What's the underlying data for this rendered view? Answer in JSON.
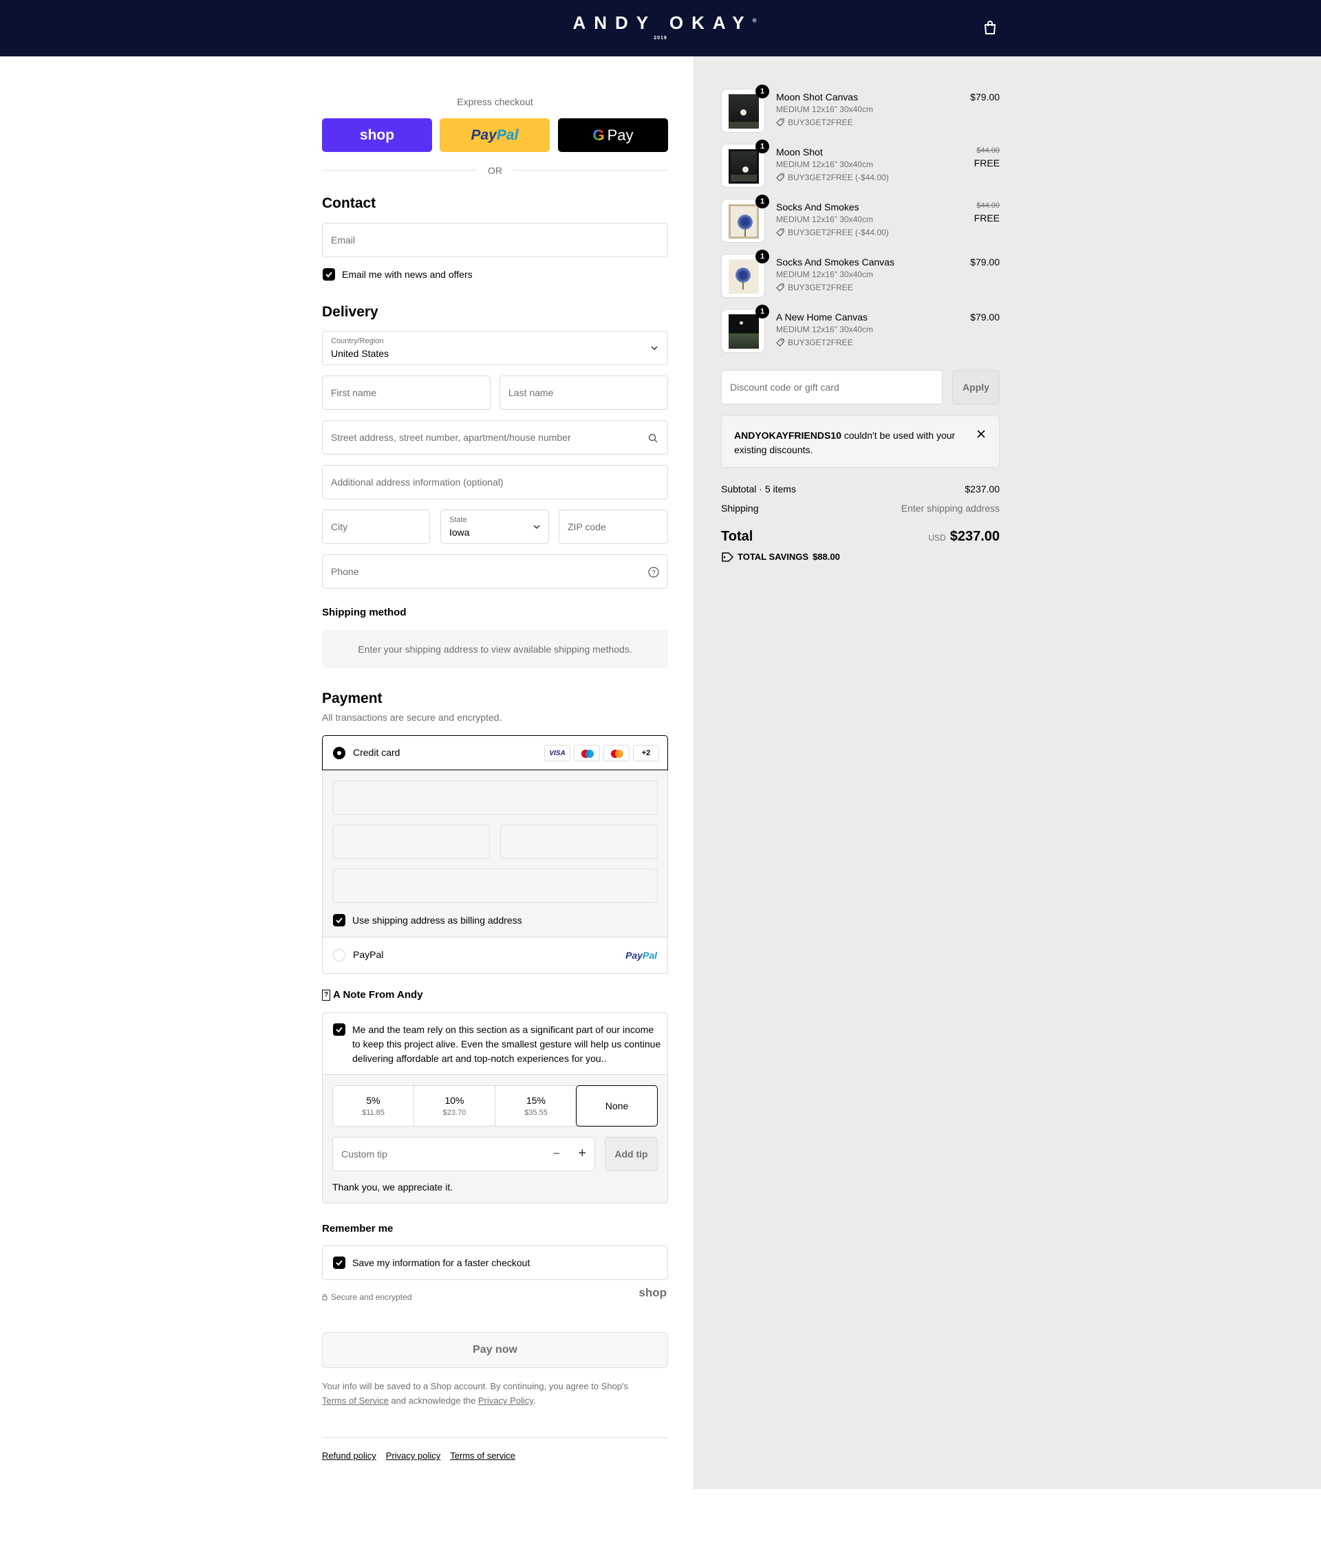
{
  "header": {
    "brand": "ANDY OKAY",
    "brand_mark": "®",
    "year": "2019",
    "cart_icon": "shopping-bag-icon"
  },
  "express": {
    "title": "Express checkout",
    "shop_label": "shop",
    "paypal_label_a": "Pay",
    "paypal_label_b": "Pal",
    "gpay_label": "Pay",
    "or": "OR",
    "colors": {
      "shop": "#5a31f4",
      "paypal": "#ffc439",
      "gpay": "#000000"
    }
  },
  "contact": {
    "title": "Contact",
    "email_placeholder": "Email",
    "newsletter_label": "Email me with news and offers"
  },
  "delivery": {
    "title": "Delivery",
    "country_label": "Country/Region",
    "country_value": "United States",
    "first_name": "First name",
    "last_name": "Last name",
    "address": "Street address, street number, apartment/house number",
    "address2": "Additional address information (optional)",
    "city": "City",
    "state_label": "State",
    "state_value": "Iowa",
    "zip": "ZIP code",
    "phone": "Phone"
  },
  "shipping": {
    "title": "Shipping method",
    "message": "Enter your shipping address to view available shipping methods."
  },
  "payment": {
    "title": "Payment",
    "subtitle": "All transactions are secure and encrypted.",
    "credit_card": "Credit card",
    "visa": "VISA",
    "more": "+2",
    "billing_label": "Use shipping address as billing address",
    "paypal": "PayPal",
    "paypal_logo_a": "Pay",
    "paypal_logo_b": "Pal"
  },
  "note": {
    "title": "A Note From Andy",
    "icon": "?",
    "text": "Me and the team rely on this section as a significant part of our income to keep this project alive. Even the smallest gesture will help us continue delivering affordable art and top-notch experiences for you..",
    "tips": [
      {
        "pct": "5%",
        "amount": "$11.85"
      },
      {
        "pct": "10%",
        "amount": "$23.70"
      },
      {
        "pct": "15%",
        "amount": "$35.55"
      }
    ],
    "none": "None",
    "custom_placeholder": "Custom tip",
    "add_tip": "Add tip",
    "thanks": "Thank you, we appreciate it."
  },
  "remember": {
    "title": "Remember me",
    "save_label": "Save my information for a faster checkout",
    "secure": "Secure and encrypted",
    "shop_logo": "shop"
  },
  "pay": {
    "button": "Pay now",
    "legal_1": "Your info will be saved to a Shop account. By continuing, you agree to Shop's",
    "tos": "Terms of Service",
    "legal_2": "and acknowledge the",
    "privacy": "Privacy Policy",
    "legal_3": "."
  },
  "footer": {
    "refund": "Refund policy",
    "privacy": "Privacy policy",
    "terms": "Terms of service"
  },
  "cart": {
    "items": [
      {
        "qty": "1",
        "name": "Moon Shot Canvas",
        "variant": "MEDIUM 12x16\" 30x40cm",
        "code": "BUY3GET2FREE",
        "price": "$79.00",
        "old": "",
        "free": "",
        "art": "moon"
      },
      {
        "qty": "1",
        "name": "Moon Shot",
        "variant": "MEDIUM 12x16\" 30x40cm",
        "code": "BUY3GET2FREE (-$44.00)",
        "price": "",
        "old": "$44.00",
        "free": "FREE",
        "art": "moon-frame"
      },
      {
        "qty": "1",
        "name": "Socks And Smokes",
        "variant": "MEDIUM 12x16\" 30x40cm",
        "code": "BUY3GET2FREE (-$44.00)",
        "price": "",
        "old": "$44.00",
        "free": "FREE",
        "art": "flower-frame"
      },
      {
        "qty": "1",
        "name": "Socks And Smokes Canvas",
        "variant": "MEDIUM 12x16\" 30x40cm",
        "code": "BUY3GET2FREE",
        "price": "$79.00",
        "old": "",
        "free": "",
        "art": "flower"
      },
      {
        "qty": "1",
        "name": "A New Home Canvas",
        "variant": "MEDIUM 12x16\" 30x40cm",
        "code": "BUY3GET2FREE",
        "price": "$79.00",
        "old": "",
        "free": "",
        "art": "home"
      }
    ],
    "discount_placeholder": "Discount code or gift card",
    "apply": "Apply",
    "error_code": "ANDYOKAYFRIENDS10",
    "error_text": "couldn't be used with your existing discounts.",
    "subtotal_label": "Subtotal · 5 items",
    "subtotal": "$237.00",
    "shipping_label": "Shipping",
    "shipping_value": "Enter shipping address",
    "total_label": "Total",
    "currency": "USD",
    "total": "$237.00",
    "savings_label": "TOTAL SAVINGS",
    "savings": "$88.00"
  }
}
